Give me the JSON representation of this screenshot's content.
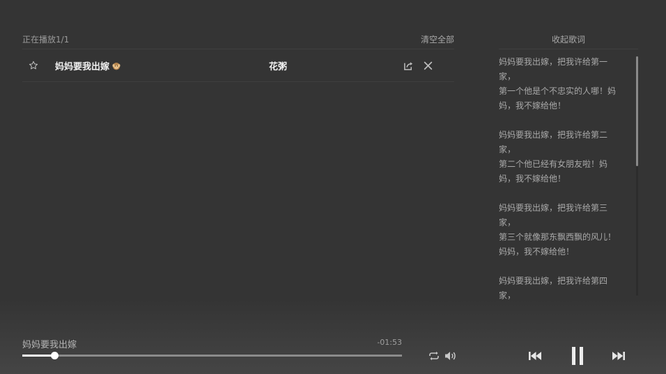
{
  "playlist": {
    "now_playing_label": "正在播放1/1",
    "clear_all_label": "清空全部",
    "items": [
      {
        "title": "妈妈要我出嫁",
        "artist": "花粥",
        "favorited": false
      }
    ]
  },
  "lyrics": {
    "collapse_label": "收起歌词",
    "paragraphs": [
      [
        "妈妈要我出嫁，把我许给第一家，",
        "第一个他是个不忠实的人哪！妈妈，我不嫁给他！"
      ],
      [
        "妈妈要我出嫁，把我许给第二家，",
        "第二个他已经有女朋友啦！妈妈，我不嫁给他！"
      ],
      [
        "妈妈要我出嫁，把我许给第三家，",
        "第三个就像那东飘西飘的风儿！妈妈，我不嫁给他！"
      ],
      [
        "妈妈要我出嫁，把我许给第四家，"
      ]
    ],
    "scroll_fraction": 0.0
  },
  "player": {
    "current_title": "妈妈要我出嫁",
    "time_remaining": "-01:53",
    "progress_fraction": 0.084,
    "state": "playing"
  },
  "colors": {
    "background": "#343434",
    "text_primary": "#f0f0f0",
    "text_secondary": "#a9a9a9",
    "progress_fill": "#ffffff",
    "progress_track": "#8b8b8b"
  }
}
